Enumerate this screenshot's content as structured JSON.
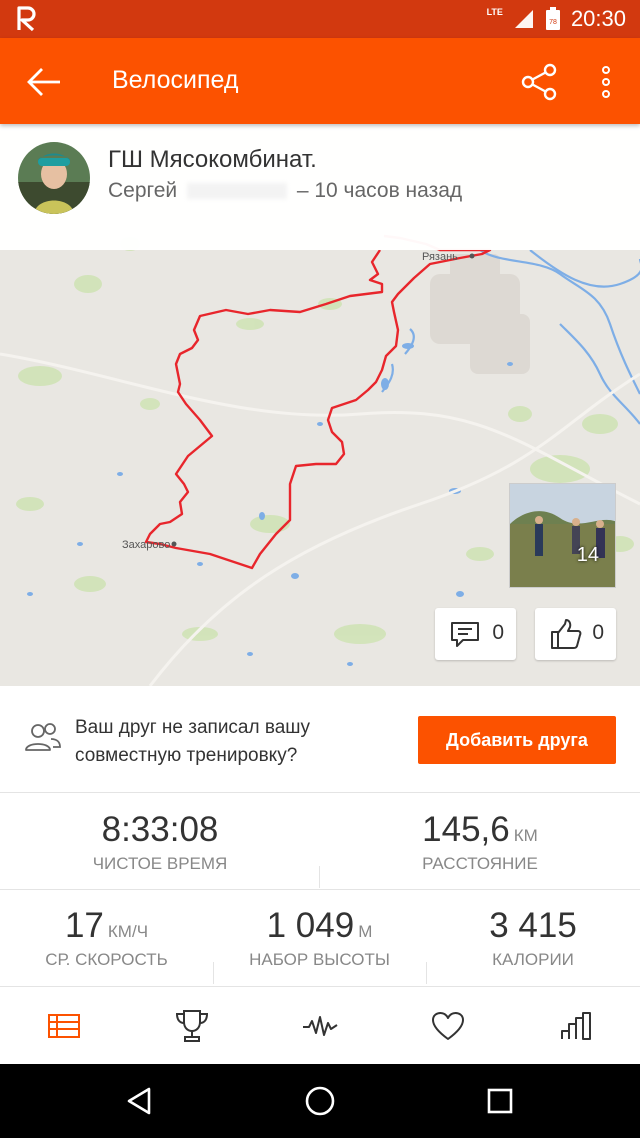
{
  "status_bar": {
    "time": "20:30",
    "network": "LTE",
    "battery_level": "78",
    "app_icon": "strava-logo-icon"
  },
  "app_bar": {
    "title": "Велосипед",
    "back_icon": "arrow-left-icon",
    "share_icon": "share-icon",
    "more_icon": "more-vertical-icon"
  },
  "activity": {
    "name": "ГШ Мясокомбинат.",
    "athlete_first_name": "Сергей",
    "time_ago": "– 10 часов назад"
  },
  "map": {
    "labels": [
      "Рязань",
      "Захарово"
    ],
    "route_color": "#e8262c"
  },
  "photos": {
    "count": "14"
  },
  "social": {
    "comments_count": "0",
    "kudos_count": "0"
  },
  "friend_prompt": {
    "text": "Ваш друг не записал вашу совместную тренировку?",
    "button_label": "Добавить друга"
  },
  "stats": {
    "moving_time": {
      "value": "8:33:08",
      "unit": "",
      "label": "ЧИСТОЕ ВРЕМЯ"
    },
    "distance": {
      "value": "145,6",
      "unit": "КМ",
      "label": "РАССТОЯНИЕ"
    },
    "avg_speed": {
      "value": "17",
      "unit": "КМ/Ч",
      "label": "СР. СКОРОСТЬ"
    },
    "elevation": {
      "value": "1 049",
      "unit": "М",
      "label": "НАБОР ВЫСОТЫ"
    },
    "calories": {
      "value": "3 415",
      "unit": "",
      "label": "КАЛОРИИ"
    }
  },
  "tabs": [
    {
      "icon": "summary-list-icon",
      "active": true
    },
    {
      "icon": "trophy-icon",
      "active": false
    },
    {
      "icon": "analysis-waveform-icon",
      "active": false
    },
    {
      "icon": "heart-icon",
      "active": false
    },
    {
      "icon": "bar-chart-icon",
      "active": false
    }
  ],
  "colors": {
    "brand": "#fc5200",
    "status_bar": "#d2390f"
  }
}
